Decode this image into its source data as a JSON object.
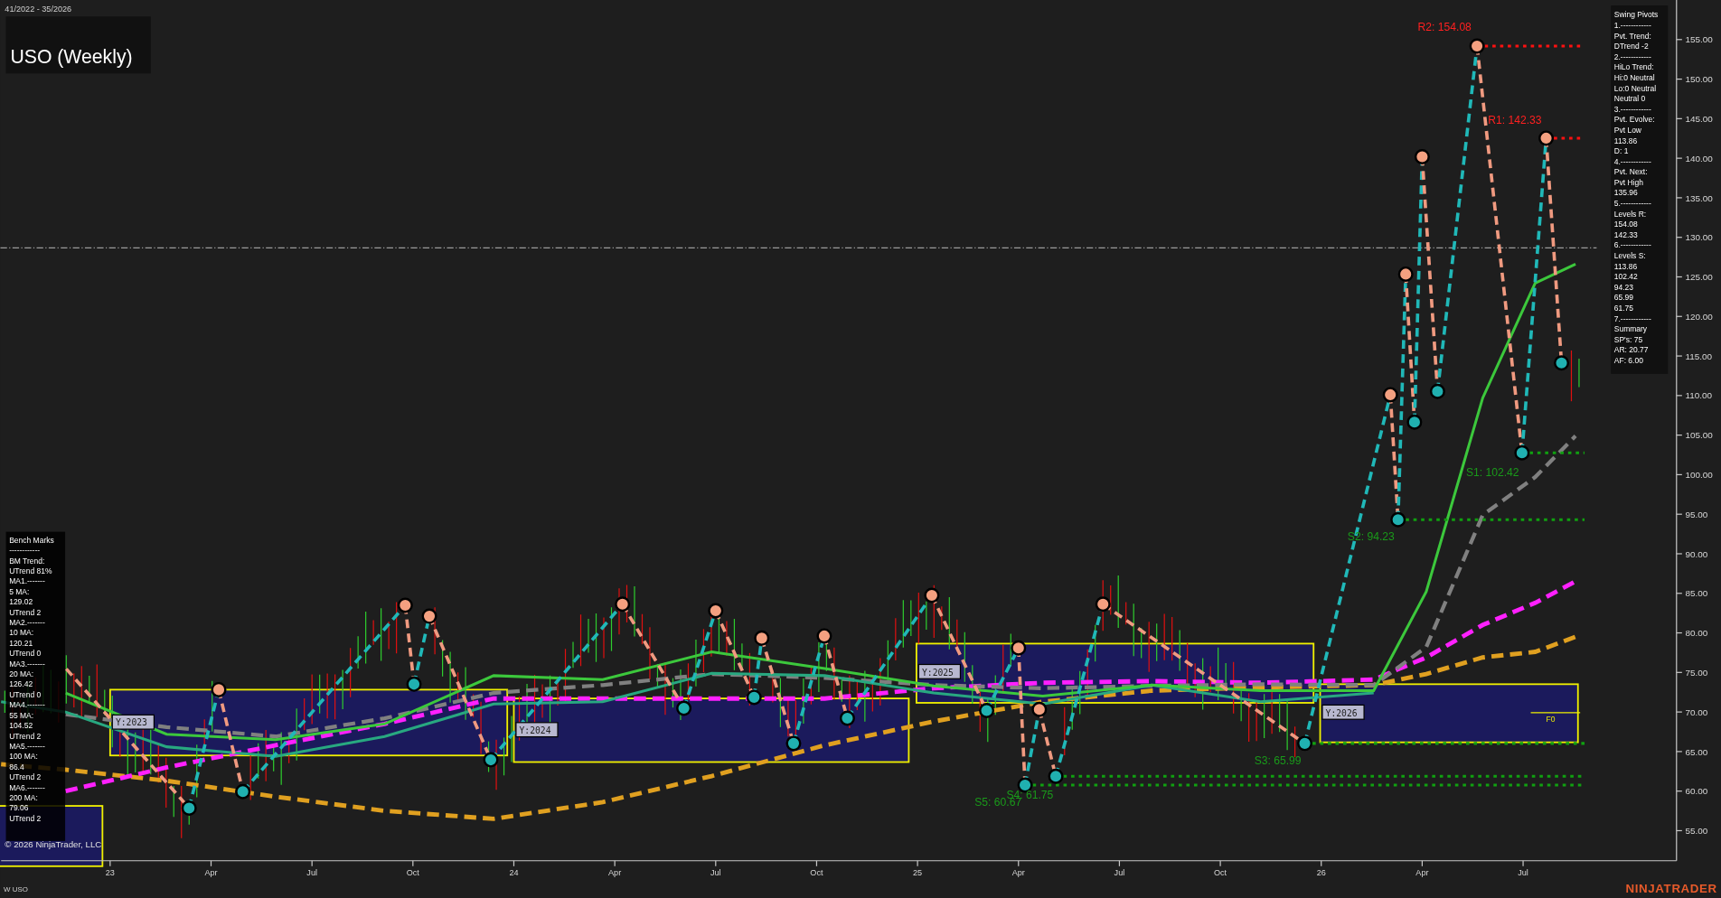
{
  "header": {
    "date_range": "41/2022 - 35/2026",
    "title": "USO (Weekly)"
  },
  "chart": {
    "chart_data": {
      "type": "line",
      "xlim": [
        2022.73,
        2026.88
      ],
      "ylim": [
        51.2,
        160.0
      ],
      "x": [
        2022.73,
        2022.89,
        2023.14,
        2023.41,
        2023.68,
        2023.95,
        2024.22,
        2024.49,
        2024.77,
        2025.04,
        2025.31,
        2025.58,
        2025.85,
        2026.13,
        2026.26,
        2026.4,
        2026.53,
        2026.63
      ],
      "xticks": [
        {
          "value": 2023,
          "label": "23"
        },
        {
          "value": 2023.25,
          "label": "Apr"
        },
        {
          "value": 2023.5,
          "label": "Jul"
        },
        {
          "value": 2023.75,
          "label": "Oct"
        },
        {
          "value": 2024,
          "label": "24"
        },
        {
          "value": 2024.25,
          "label": "Apr"
        },
        {
          "value": 2024.5,
          "label": "Jul"
        },
        {
          "value": 2024.75,
          "label": "Oct"
        },
        {
          "value": 2025,
          "label": "25"
        },
        {
          "value": 2025.25,
          "label": "Apr"
        },
        {
          "value": 2025.5,
          "label": "Jul"
        },
        {
          "value": 2025.75,
          "label": "Oct"
        },
        {
          "value": 2026,
          "label": "26"
        },
        {
          "value": 2026.25,
          "label": "Apr"
        },
        {
          "value": 2026.5,
          "label": "Jul"
        }
      ],
      "yticks": [
        {
          "value": 155,
          "label": "155.00"
        },
        {
          "value": 150,
          "label": "150.00"
        },
        {
          "value": 145,
          "label": "145.00"
        },
        {
          "value": 140,
          "label": "140.00"
        },
        {
          "value": 135,
          "label": "135.00"
        },
        {
          "value": 130,
          "label": "130.00"
        },
        {
          "value": 125,
          "label": "125.00"
        },
        {
          "value": 120,
          "label": "120.00"
        },
        {
          "value": 115,
          "label": "115.00"
        },
        {
          "value": 110,
          "label": "110.00"
        },
        {
          "value": 105,
          "label": "105.00"
        },
        {
          "value": 100,
          "label": "100.00"
        },
        {
          "value": 95,
          "label": "95.00"
        },
        {
          "value": 90,
          "label": "90.00"
        },
        {
          "value": 85,
          "label": "85.00"
        },
        {
          "value": 80,
          "label": "80.00"
        },
        {
          "value": 75,
          "label": "75.00"
        },
        {
          "value": 70,
          "label": "70.00"
        },
        {
          "value": 65,
          "label": "65.00"
        },
        {
          "value": 60,
          "label": "60.00"
        },
        {
          "value": 55,
          "label": "55.00"
        }
      ],
      "series": [
        {
          "color": "#e0a020",
          "line_style": "dashed",
          "values": [
            63.4,
            62.7,
            61.3,
            59.3,
            57.5,
            56.5,
            58.6,
            61.9,
            65.8,
            68.8,
            71.3,
            72.7,
            73.1,
            73.4,
            74.8,
            76.9,
            77.6,
            79.5
          ]
        },
        {
          "color": "#ff20ff",
          "line_style": "dashed",
          "values": [
            null,
            60.0,
            63.0,
            65.8,
            68.5,
            71.7,
            71.7,
            71.7,
            71.7,
            73.0,
            73.7,
            73.9,
            73.7,
            74.1,
            76.9,
            81.0,
            83.8,
            86.5
          ]
        },
        {
          "color": "#808080",
          "line_style": "dashed",
          "values": [
            null,
            69.7,
            68.1,
            66.9,
            69.2,
            72.4,
            73.4,
            74.8,
            74.3,
            73.4,
            73.0,
            73.3,
            73.5,
            73.4,
            78.2,
            94.9,
            99.7,
            104.9
          ]
        },
        {
          "color": "#28a880",
          "line_style": "solid",
          "values": [
            71.3,
            70.0,
            65.6,
            64.4,
            66.9,
            71.0,
            71.3,
            74.9,
            74.6,
            72.4,
            71.0,
            73.4,
            71.3,
            72.4,
            null,
            null,
            null,
            null
          ]
        },
        {
          "color": "#3cc83c",
          "line_style": "solid",
          "values": [
            null,
            72.4,
            67.2,
            66.5,
            68.5,
            74.6,
            74.1,
            77.6,
            75.5,
            73.3,
            72.0,
            73.4,
            72.7,
            72.7,
            85.2,
            109.7,
            124.2,
            126.6
          ]
        }
      ]
    }
  },
  "level_labels": [
    {
      "text": "R2: 154.08",
      "kind": "resistance"
    },
    {
      "text": "R1: 142.33",
      "kind": "resistance"
    },
    {
      "text": "S1: 102.42",
      "kind": "support"
    },
    {
      "text": "S2: 94.23",
      "kind": "support"
    },
    {
      "text": "S3: 65.99",
      "kind": "support"
    },
    {
      "text": "S4: 61.75",
      "kind": "support"
    },
    {
      "text": "S5: 60.67",
      "kind": "support"
    }
  ],
  "year_tags": [
    "Y:2023",
    "Y:2024",
    "Y:2025",
    "Y:2026"
  ],
  "forecast_tag": "F0",
  "swing_pivots_panel": {
    "lines": [
      "Swing Pivots",
      "1.------------",
      "Pvt. Trend:",
      "DTrend -2",
      "2.------------",
      "HiLo Trend:",
      "Hi:0 Neutral",
      "Lo:0 Neutral",
      "Neutral 0",
      "3.------------",
      "Pvt. Evolve:",
      "Pvt Low",
      "113.86",
      "D: 1",
      "4.------------",
      "Pvt. Next:",
      "Pvt High",
      "135.96",
      "5.------------",
      "Levels R:",
      "154.08",
      "142.33",
      "6.------------",
      "Levels S:",
      "113.86",
      "102.42",
      "94.23",
      "65.99",
      "61.75",
      "7.------------",
      "Summary",
      "SP's: 75",
      "AR: 20.77",
      "AF: 6.00"
    ]
  },
  "bench_marks_panel": {
    "lines": [
      "Bench Marks",
      "------------",
      "BM Trend:",
      "UTrend 81%",
      "MA1.-------",
      "5 MA:",
      "129.02",
      "UTrend 2",
      "MA2.-------",
      "10 MA:",
      "120.21",
      "UTrend 0",
      "MA3.-------",
      "20 MA:",
      "126.42",
      "UTrend 0",
      "MA4.-------",
      "55 MA:",
      "104.52",
      "UTrend 2",
      "MA5.-------",
      "100 MA:",
      "86.4",
      "UTrend 2",
      "MA6.-------",
      "200 MA:",
      "79.06",
      "UTrend 2"
    ]
  },
  "copyright": "© 2026 NinjaTrader, LLC",
  "footer": {
    "instrument": "W USO",
    "logo": "NINJATRADER"
  }
}
